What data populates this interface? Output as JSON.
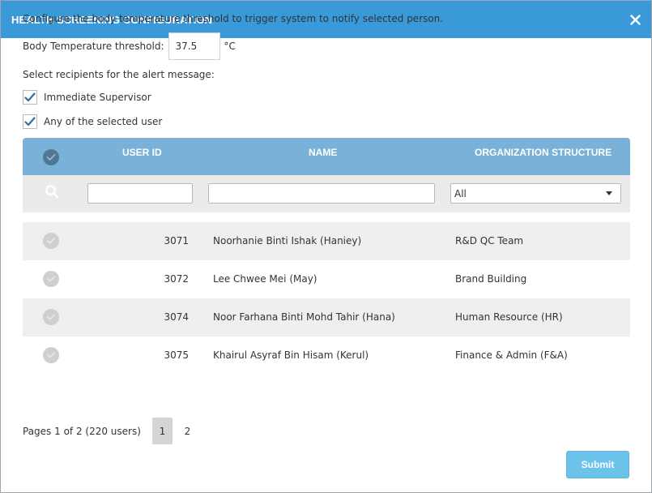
{
  "dialog": {
    "title": "HEALTH SCREENING CONFIGURATION",
    "close_icon": "close-icon"
  },
  "config": {
    "description": "Configure the body temperature threshold to trigger system to notify selected person.",
    "threshold_label": "Body Temperature threshold:",
    "threshold_value": "37.5",
    "threshold_unit": "°C",
    "recipients_label": "Select recipients for the alert message:"
  },
  "recipients": [
    {
      "label": "Immediate Supervisor",
      "checked": true
    },
    {
      "label": "Any of the selected user",
      "checked": true
    }
  ],
  "table": {
    "headers": {
      "user_id": "USER ID",
      "name": "NAME",
      "org": "ORGANIZATION STRUCTURE"
    },
    "filters": {
      "user_id": "",
      "name": "",
      "org_selected": "All"
    },
    "rows": [
      {
        "user_id": "3071",
        "name": "Noorhanie Binti Ishak (Haniey)",
        "org": "R&D QC Team"
      },
      {
        "user_id": "3072",
        "name": "Lee Chwee Mei (May)",
        "org": "Brand Building"
      },
      {
        "user_id": "3074",
        "name": "Noor Farhana Binti Mohd Tahir (Hana)",
        "org": "Human Resource (HR)"
      },
      {
        "user_id": "3075",
        "name": "Khairul Asyraf Bin Hisam (Kerul)",
        "org": "Finance & Admin (F&A)"
      }
    ]
  },
  "pagination": {
    "info": "Pages 1 of 2 (220 users)",
    "pages": [
      "1",
      "2"
    ],
    "current": "1"
  },
  "actions": {
    "submit_label": "Submit"
  },
  "colors": {
    "titlebar": "#3a9ad9",
    "table_header": "#7ab1d8",
    "checkbox_check": "#2f6f9f",
    "submit": "#6bc3ea"
  }
}
